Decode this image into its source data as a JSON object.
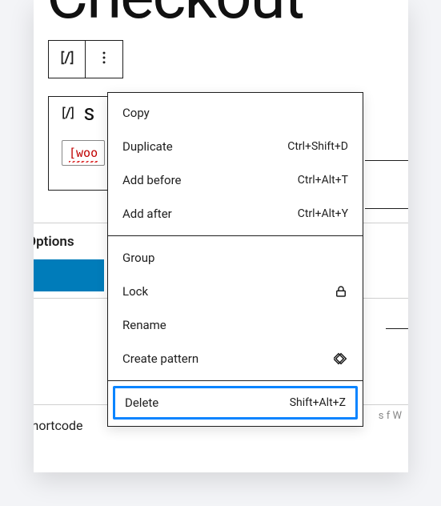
{
  "page": {
    "title": "Checkout",
    "options_label": "e Options",
    "footer_label": "Shortcode",
    "right_cutoff": "s f\nW"
  },
  "block": {
    "header_text": "S",
    "shortcode_text": "[woo"
  },
  "menu": {
    "section1": [
      {
        "label": "Copy",
        "shortcut": ""
      },
      {
        "label": "Duplicate",
        "shortcut": "Ctrl+Shift+D"
      },
      {
        "label": "Add before",
        "shortcut": "Ctrl+Alt+T"
      },
      {
        "label": "Add after",
        "shortcut": "Ctrl+Alt+Y"
      }
    ],
    "section2": [
      {
        "label": "Group",
        "shortcut": "",
        "icon": ""
      },
      {
        "label": "Lock",
        "shortcut": "",
        "icon": "lock"
      },
      {
        "label": "Rename",
        "shortcut": "",
        "icon": ""
      },
      {
        "label": "Create pattern",
        "shortcut": "",
        "icon": "pattern"
      }
    ],
    "delete": {
      "label": "Delete",
      "shortcut": "Shift+Alt+Z"
    }
  }
}
